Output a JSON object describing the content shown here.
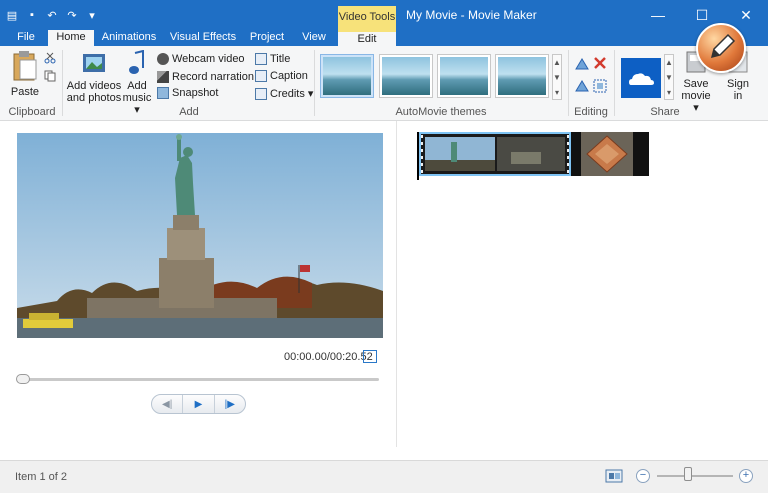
{
  "window": {
    "title": "My Movie - Movie Maker",
    "contextual_tab": "Video Tools",
    "controls": {
      "minimize": "—",
      "maximize": "☐",
      "close": "✕"
    }
  },
  "qat": {
    "save_icon": "save-icon",
    "undo_icon": "undo-icon",
    "redo_icon": "redo-icon"
  },
  "tabs": {
    "file": "File",
    "home": "Home",
    "animations": "Animations",
    "visual_effects": "Visual Effects",
    "project": "Project",
    "view": "View",
    "edit": "Edit"
  },
  "ribbon": {
    "clipboard": {
      "paste": "Paste",
      "label": "Clipboard"
    },
    "add": {
      "add_videos_line1": "Add videos",
      "add_videos_line2": "and photos",
      "add_music_line1": "Add",
      "add_music_line2": "music",
      "webcam": "Webcam video",
      "narration": "Record narration",
      "snapshot": "Snapshot",
      "title": "Title",
      "caption": "Caption",
      "credits": "Credits",
      "label": "Add"
    },
    "themes": {
      "label": "AutoMovie themes"
    },
    "editing": {
      "label": "Editing"
    },
    "share": {
      "save_line1": "Save",
      "save_line2": "movie",
      "sign_line1": "Sign",
      "sign_line2": "in",
      "label": "Share"
    }
  },
  "preview": {
    "timecode": "00:00.00/00:20.52",
    "progress": 0.0
  },
  "status": {
    "item_text": "Item 1 of 2",
    "zoom_minus": "−",
    "zoom_plus": "+",
    "zoom_level": 0.4
  },
  "colors": {
    "accent": "#1f6fc5",
    "video_tools_tab": "#f7e27a",
    "selection": "#7ec3f3"
  }
}
